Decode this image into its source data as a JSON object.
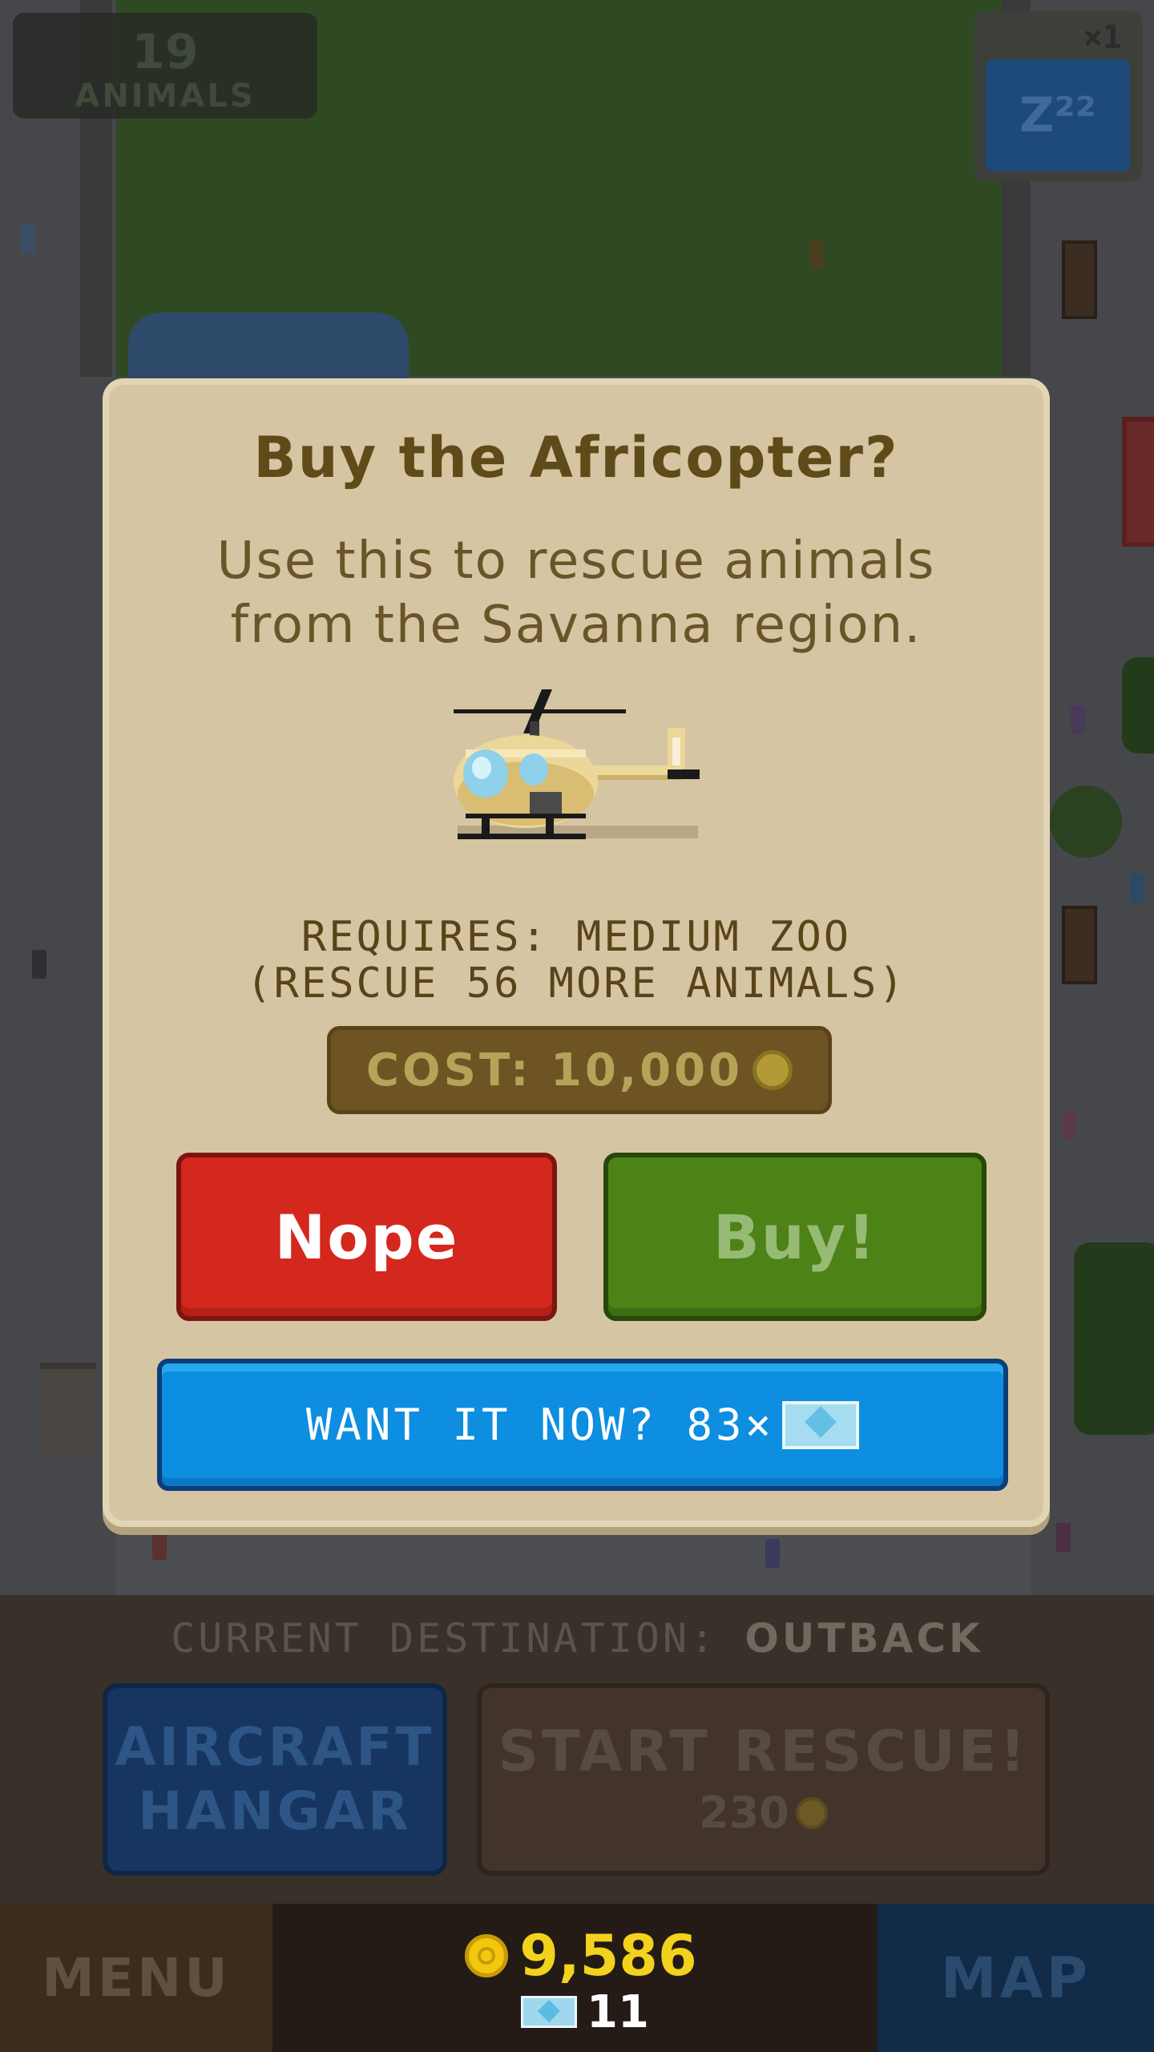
{
  "background": {
    "animal_counter": {
      "number": "19",
      "label": "ANIMALS"
    },
    "speed": {
      "multiplier": "×1",
      "sleep_label": "Z²²"
    }
  },
  "dialog": {
    "title": "Buy the Africopter?",
    "body_lines": [
      "Use this to rescue animals",
      "from the Savanna region."
    ],
    "requires_lines": [
      "REQUIRES: MEDIUM ZOO",
      "(RESCUE 56 MORE ANIMALS)"
    ],
    "cost_label": "COST: 10,000",
    "nope_label": "Nope",
    "buy_label": "Buy!",
    "want_label": "WANT IT NOW? 83×",
    "icons": {
      "aircraft": "helicopter-icon",
      "coin": "coin-icon",
      "gem": "gem-bill-icon"
    }
  },
  "hud": {
    "destination_prefix": "CURRENT DESTINATION:",
    "destination_name": "OUTBACK",
    "hangar_lines": [
      "AIRCRAFT",
      "HANGAR"
    ],
    "rescue_title": "START RESCUE!",
    "rescue_cost": "230",
    "menu_label": "MENU",
    "map_label": "MAP",
    "coins": "9,586",
    "gems": "11"
  },
  "colors": {
    "dialog_bg": "#d6c5a2",
    "nope_red": "#d4271d",
    "buy_green": "#4c8216",
    "want_blue": "#0d8ee0",
    "coin_gold": "#f2d21c"
  }
}
